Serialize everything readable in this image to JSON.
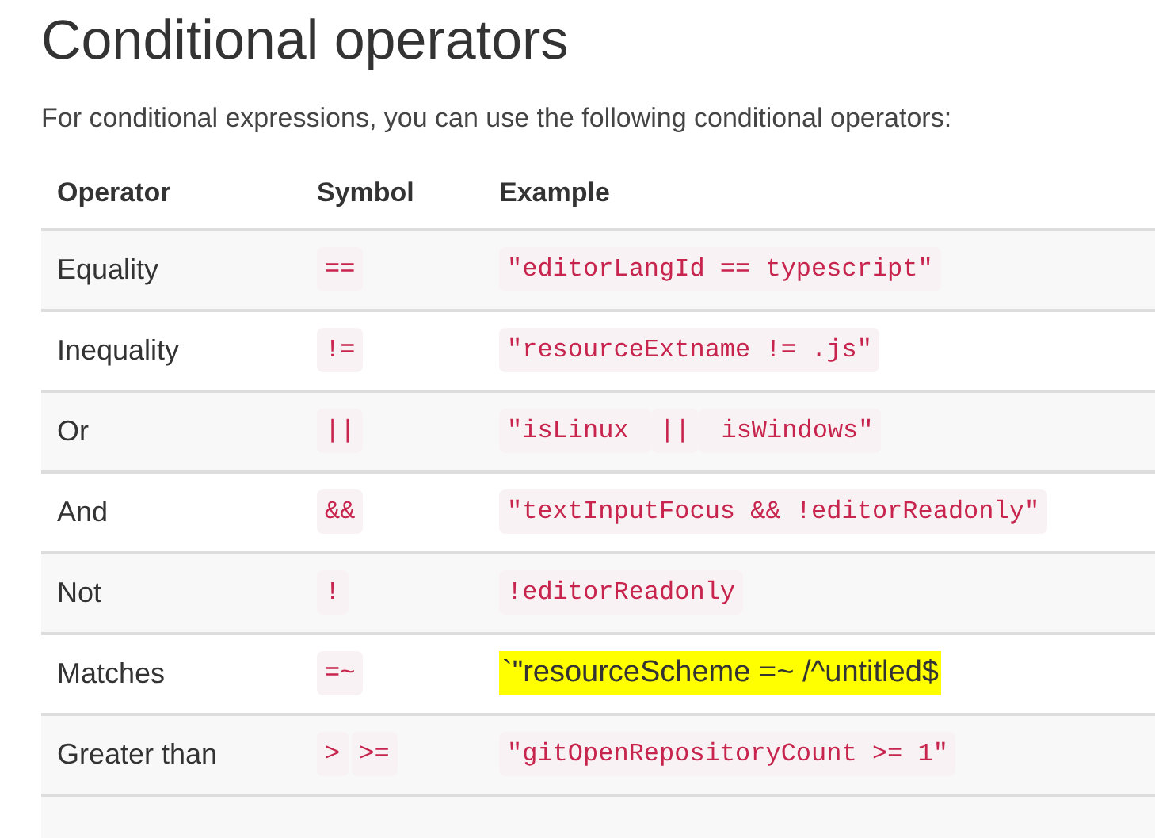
{
  "title": "Conditional operators",
  "intro": "For conditional expressions, you can use the following conditional operators:",
  "table": {
    "columns": [
      "Operator",
      "Symbol",
      "Example"
    ],
    "rows": [
      {
        "operator": "Equality",
        "symbols": [
          "=="
        ],
        "example": {
          "kind": "code",
          "parts": [
            "\"editorLangId == typescript\""
          ]
        }
      },
      {
        "operator": "Inequality",
        "symbols": [
          "!="
        ],
        "example": {
          "kind": "code",
          "parts": [
            "\"resourceExtname != .js\""
          ]
        }
      },
      {
        "operator": "Or",
        "symbols": [
          "||"
        ],
        "example": {
          "kind": "code",
          "parts": [
            "\"isLinux ",
            "||",
            " isWindows\""
          ]
        }
      },
      {
        "operator": "And",
        "symbols": [
          "&&"
        ],
        "example": {
          "kind": "code",
          "parts": [
            "\"textInputFocus && !editorReadonly\""
          ]
        }
      },
      {
        "operator": "Not",
        "symbols": [
          "!"
        ],
        "example": {
          "kind": "code",
          "parts": [
            "!editorReadonly"
          ]
        }
      },
      {
        "operator": "Matches",
        "symbols": [
          "=~"
        ],
        "example": {
          "kind": "highlighted",
          "parts": [
            "`\"resourceScheme =~ /^untitled$"
          ]
        }
      },
      {
        "operator": "Greater than",
        "symbols": [
          ">",
          ">="
        ],
        "example": {
          "kind": "code",
          "parts": [
            "\"gitOpenRepositoryCount >= 1\""
          ]
        }
      }
    ]
  }
}
